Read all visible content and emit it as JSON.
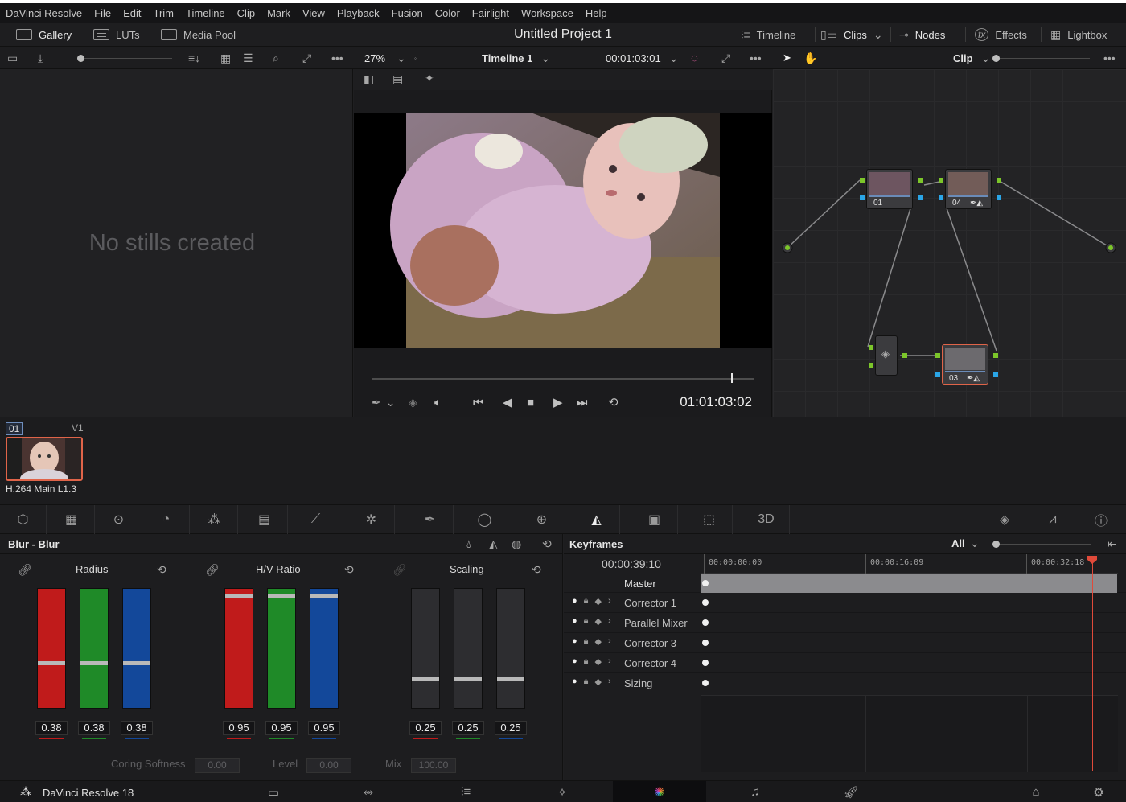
{
  "menu": [
    "DaVinci Resolve",
    "File",
    "Edit",
    "Trim",
    "Timeline",
    "Clip",
    "Mark",
    "View",
    "Playback",
    "Fusion",
    "Color",
    "Fairlight",
    "Workspace",
    "Help"
  ],
  "header": {
    "left_buttons": [
      "Gallery",
      "LUTs",
      "Media Pool"
    ],
    "project_title": "Untitled Project 1",
    "right_buttons": [
      "Timeline",
      "Clips",
      "Nodes",
      "Effects",
      "Lightbox"
    ]
  },
  "viewer_bar": {
    "zoom": "27%",
    "timeline_name": "Timeline 1",
    "source_timecode": "00:01:03:01",
    "node_mode": "Clip"
  },
  "gallery": {
    "empty_text": "No stills created"
  },
  "viewer": {
    "timecode": "01:01:03:02",
    "playhead_progress": 0.94
  },
  "nodes": [
    {
      "label": "01"
    },
    {
      "label": "04"
    },
    {
      "label": "03"
    }
  ],
  "clip": {
    "number": "01",
    "track": "V1",
    "codec": "H.264 Main L1.3"
  },
  "blur": {
    "title": "Blur - Blur",
    "groups": [
      {
        "name": "Radius",
        "values": [
          "0.38",
          "0.38",
          "0.38"
        ],
        "level": 0.38
      },
      {
        "name": "H/V Ratio",
        "values": [
          "0.95",
          "0.95",
          "0.95"
        ],
        "level": 0.95
      },
      {
        "name": "Scaling",
        "values": [
          "0.25",
          "0.25",
          "0.25"
        ],
        "level": 0.25
      }
    ],
    "coring_softness_label": "Coring Softness",
    "coring_softness": "0.00",
    "level_label": "Level",
    "level": "0.00",
    "mix_label": "Mix",
    "mix": "100.00"
  },
  "keyframes": {
    "title": "Keyframes",
    "filter": "All",
    "current_timecode": "00:00:39:10",
    "ruler": [
      "00:00:00:00",
      "00:00:16:09",
      "00:00:32:18"
    ],
    "master_label": "Master",
    "rows": [
      "Corrector 1",
      "Parallel Mixer",
      "Corrector 3",
      "Corrector 4",
      "Sizing"
    ]
  },
  "status": {
    "app": "DaVinci Resolve 18"
  },
  "colors": {
    "red": "#c01b1b",
    "green": "#1f8a28",
    "blue": "#13489a",
    "accent": "#e06449"
  }
}
